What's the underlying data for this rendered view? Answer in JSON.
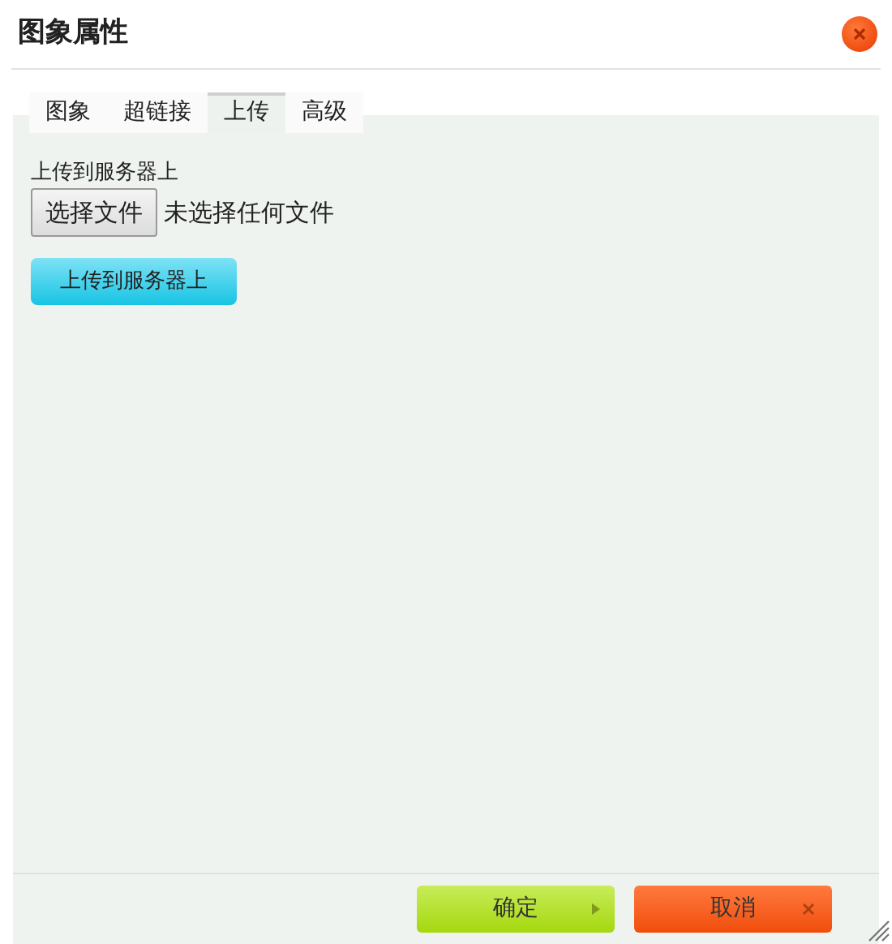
{
  "dialog": {
    "title": "图象属性"
  },
  "tabs": [
    {
      "label": "图象",
      "selected": false
    },
    {
      "label": "超链接",
      "selected": false
    },
    {
      "label": "上传",
      "selected": true
    },
    {
      "label": "高级",
      "selected": false
    }
  ],
  "upload": {
    "label": "上传到服务器上",
    "file_button": "选择文件",
    "file_status": "未选择任何文件",
    "submit": "上传到服务器上"
  },
  "buttons": [
    {
      "kind": "ok",
      "label": "确定"
    },
    {
      "kind": "cancel",
      "label": "取消"
    }
  ]
}
